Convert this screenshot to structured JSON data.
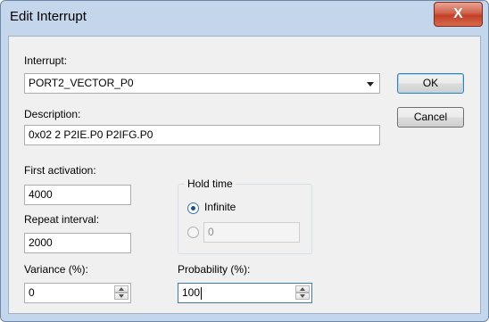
{
  "window": {
    "title": "Edit Interrupt",
    "close_glyph": "X"
  },
  "interrupt": {
    "label": "Interrupt:",
    "value": "PORT2_VECTOR_P0"
  },
  "description": {
    "label": "Description:",
    "value": "0x02  2  P2IE.P0  P2IFG.P0"
  },
  "buttons": {
    "ok": "OK",
    "cancel": "Cancel"
  },
  "first_activation": {
    "label": "First activation:",
    "value": "4000"
  },
  "repeat_interval": {
    "label": "Repeat interval:",
    "value": "2000"
  },
  "variance": {
    "label": "Variance (%):",
    "value": "0"
  },
  "hold_time": {
    "title": "Hold time",
    "infinite_label": "Infinite",
    "infinite_selected": true,
    "value": "0"
  },
  "probability": {
    "label": "Probability (%):",
    "value": "100"
  },
  "colors": {
    "titlebar": "#c3d6ec",
    "close_button": "#c7432a",
    "client_bg": "#f0f0f0"
  }
}
